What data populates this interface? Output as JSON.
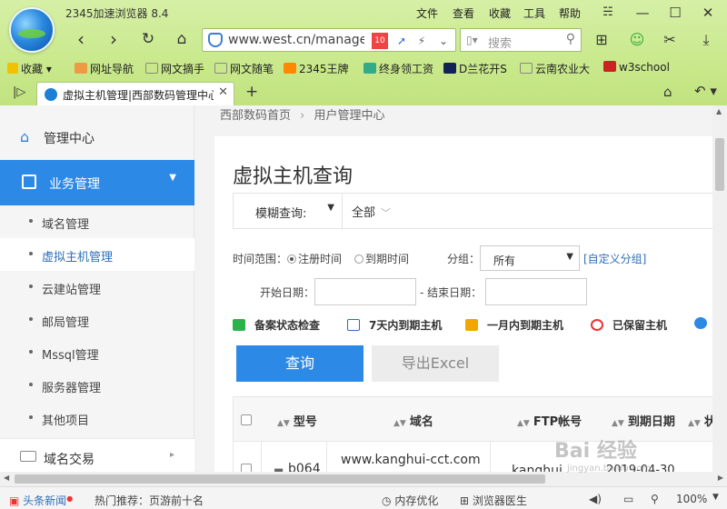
{
  "browser": {
    "title": "2345加速浏览器 8.4",
    "menu": [
      "文件",
      "查看",
      "收藏",
      "工具",
      "帮助"
    ],
    "url": "www.west.cn/manage",
    "search_placeholder": "搜索",
    "bookmarks": [
      "收藏",
      "网址导航",
      "网文摘手",
      "网文随笔",
      "2345王牌",
      "终身领工资",
      "D兰花开S",
      "云南农业大",
      "w3school"
    ],
    "tab_title": "虚拟主机管理|西部数码管理中心"
  },
  "sidebar": {
    "home": "管理中心",
    "business": "业务管理",
    "items": [
      "域名管理",
      "虚拟主机管理",
      "云建站管理",
      "邮局管理",
      "Mssql管理",
      "服务器管理",
      "其他项目"
    ],
    "active_index": 1,
    "domain_trade": "域名交易"
  },
  "breadcrumb": {
    "home": "西部数码首页",
    "current": "用户管理中心"
  },
  "main": {
    "title": "虚拟主机查询",
    "fuzzy_label": "模糊查询:",
    "scope_value": "全部",
    "time_range_label": "时间范围：",
    "radio_register": "注册时间",
    "radio_expire": "到期时间",
    "group_label": "分组：",
    "group_value": "所有",
    "custom_group": "[自定义分组]",
    "start_date_label": "开始日期：",
    "end_date_label": "- 结束日期：",
    "quick_filters": [
      "备案状态检查",
      "7天内到期主机",
      "一月内到期主机",
      "已保留主机"
    ],
    "query_button": "查询",
    "export_button": "导出Excel"
  },
  "table": {
    "columns": [
      "型号",
      "域名",
      "FTP帐号",
      "到期日期",
      "状"
    ],
    "rows": [
      {
        "model": "b064",
        "domain": "www.kanghui-cct.com",
        "ftp": "kanghui",
        "expire": "2019-04-30"
      }
    ]
  },
  "statusbar": {
    "news": "头条新闻",
    "hot": "热门推荐：页游前十名",
    "memory": "内存优化",
    "doctor": "浏览器医生",
    "zoom": "100%"
  },
  "watermark": {
    "main": "Bai 经验",
    "sub": "jingyan.baidu.com"
  },
  "colors": {
    "accent": "#2d89e6",
    "chrome_green": "#c9e98c"
  }
}
